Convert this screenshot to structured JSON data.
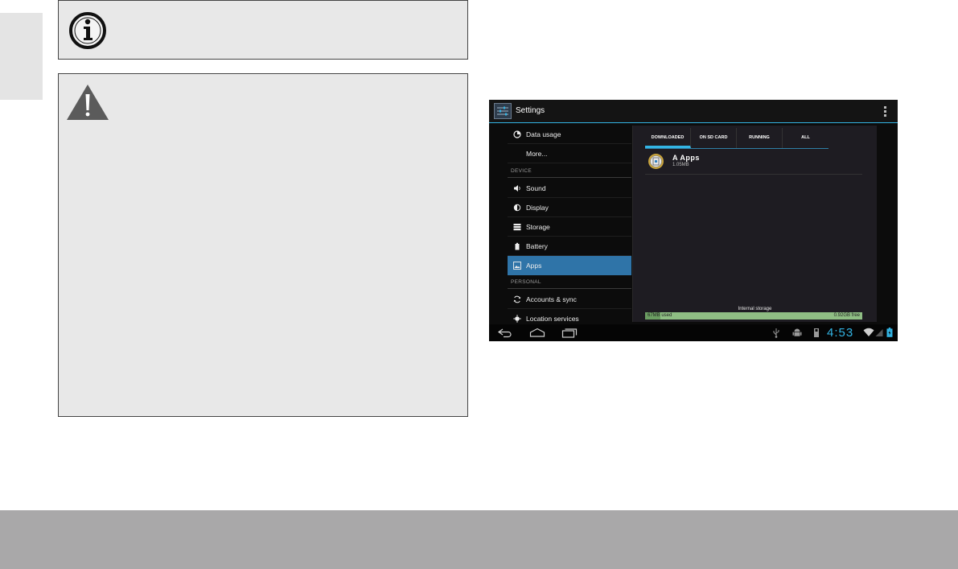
{
  "android": {
    "action_bar": {
      "title": "Settings"
    },
    "nav": {
      "data_usage": "Data usage",
      "more": "More...",
      "device_header": "DEVICE",
      "sound": "Sound",
      "display": "Display",
      "storage": "Storage",
      "battery": "Battery",
      "apps": "Apps",
      "personal_header": "PERSONAL",
      "accounts": "Accounts & sync",
      "location": "Location services"
    },
    "tabs": [
      "DOWNLOADED",
      "ON SD CARD",
      "RUNNING",
      "ALL"
    ],
    "active_tab": 0,
    "app": {
      "name": "A Apps",
      "size": "1.05MB"
    },
    "storage": {
      "label": "Internal storage",
      "used": "67MB used",
      "free": "0.92GB free",
      "used_fraction": 0.07
    },
    "clock": "4:53"
  },
  "colors": {
    "accent": "#33b5e5",
    "selected": "#2f74a8",
    "storage_bar": "#8fbe84"
  }
}
